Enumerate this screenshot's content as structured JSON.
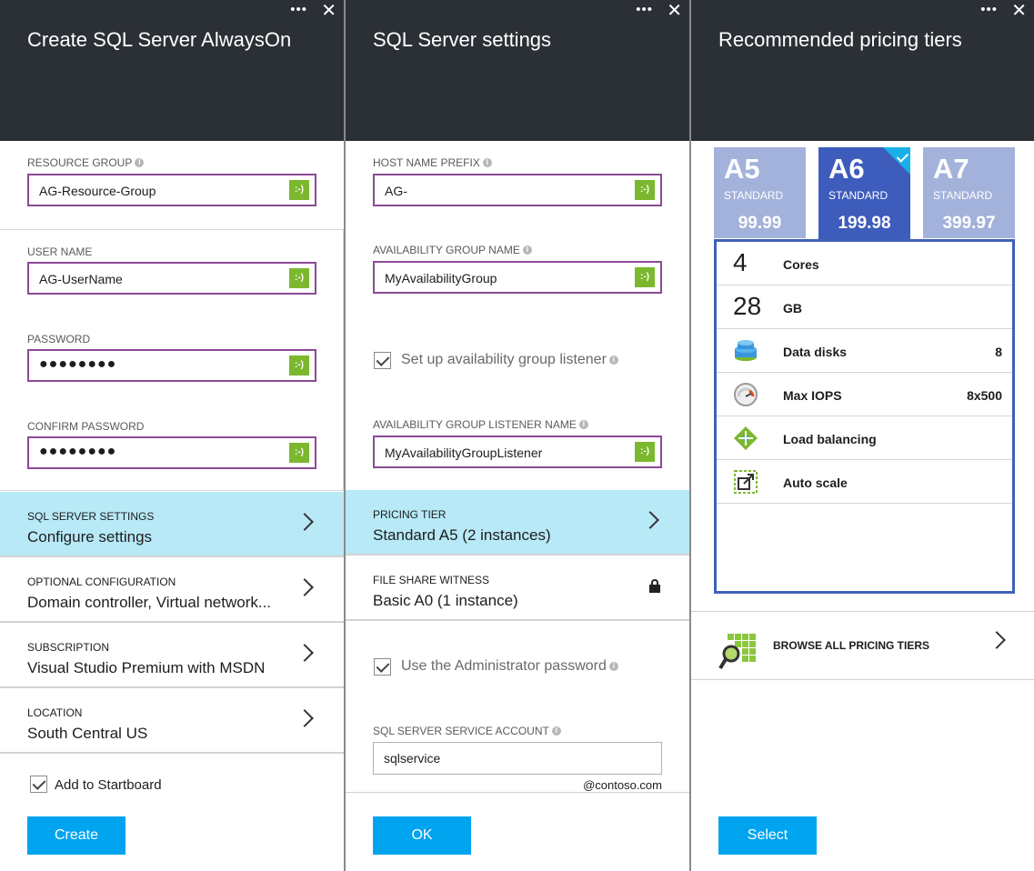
{
  "blade1": {
    "title": "Create SQL Server AlwaysOn",
    "resource_group_label": "RESOURCE GROUP",
    "resource_group_value": "AG-Resource-Group",
    "user_name_label": "USER NAME",
    "user_name_value": "AG-UserName",
    "password_label": "PASSWORD",
    "password_value": "●●●●●●●●",
    "confirm_password_label": "CONFIRM PASSWORD",
    "confirm_password_value": "●●●●●●●●",
    "nav": [
      {
        "label": "SQL SERVER SETTINGS",
        "value": "Configure settings"
      },
      {
        "label": "OPTIONAL CONFIGURATION",
        "value": "Domain controller, Virtual network..."
      },
      {
        "label": "SUBSCRIPTION",
        "value": "Visual Studio Premium with MSDN"
      },
      {
        "label": "LOCATION",
        "value": "South Central US"
      }
    ],
    "startboard_label": "Add to Startboard",
    "create_button": "Create"
  },
  "blade2": {
    "title": "SQL Server settings",
    "host_prefix_label": "HOST NAME PREFIX",
    "host_prefix_value": "AG-",
    "ag_name_label": "AVAILABILITY GROUP NAME",
    "ag_name_value": "MyAvailabilityGroup",
    "listener_checkbox_label": "Set up availability group listener",
    "listener_name_label": "AVAILABILITY GROUP LISTENER NAME",
    "listener_name_value": "MyAvailabilityGroupListener",
    "pricing_tier_label": "PRICING TIER",
    "pricing_tier_value": "Standard A5 (2 instances)",
    "file_share_label": "FILE SHARE WITNESS",
    "file_share_value": "Basic A0 (1 instance)",
    "admin_pw_label": "Use the Administrator password",
    "service_account_label": "SQL SERVER SERVICE ACCOUNT",
    "service_account_value": "sqlservice",
    "domain_suffix": "@contoso.com",
    "ok_button": "OK"
  },
  "blade3": {
    "title": "Recommended pricing tiers",
    "tiers": [
      {
        "name": "A5",
        "tier": "STANDARD",
        "price": "99.99"
      },
      {
        "name": "A6",
        "tier": "STANDARD",
        "price": "199.98"
      },
      {
        "name": "A7",
        "tier": "STANDARD",
        "price": "399.97"
      }
    ],
    "specs": {
      "cores_value": "4",
      "cores_label": "Cores",
      "memory_value": "28",
      "memory_label": "GB",
      "data_disks_label": "Data disks",
      "data_disks_value": "8",
      "max_iops_label": "Max IOPS",
      "max_iops_value": "8x500",
      "load_balancing_label": "Load balancing",
      "auto_scale_label": "Auto scale"
    },
    "browse_label": "BROWSE ALL PRICING TIERS",
    "select_button": "Select"
  },
  "common": {
    "dots": "•••",
    "close": "✕",
    "ok_badge": ":-)",
    "info": "i"
  },
  "colors": {
    "header_bg": "#2b3036",
    "accent_button": "#00a4ef",
    "selected_row": "#b7e9f7",
    "field_border": "#8c4a96",
    "valid_badge": "#7cb82f",
    "tier_selected": "#3e5cbb",
    "tier_unselected": "#a3b2db"
  }
}
